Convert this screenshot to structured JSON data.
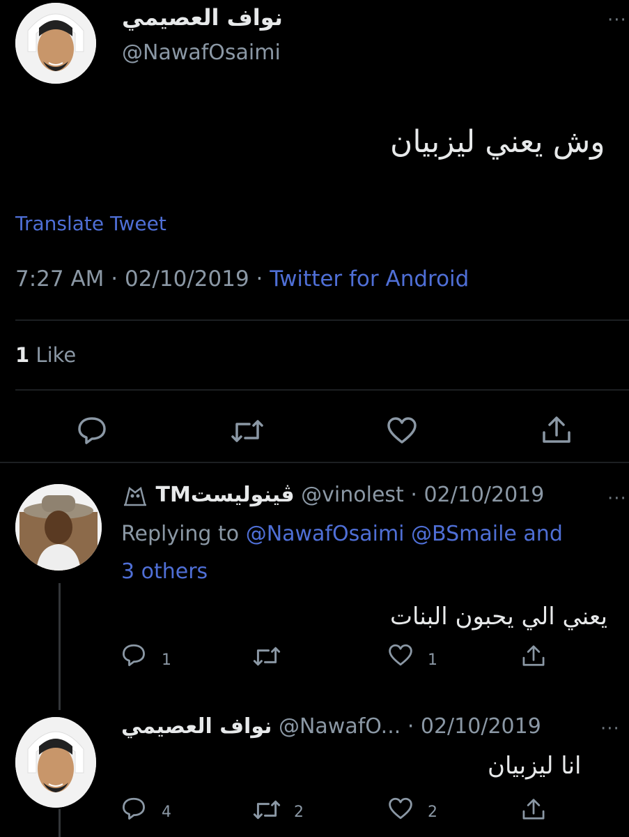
{
  "main_tweet": {
    "display_name": "نواف العصيمي",
    "handle": "@NawafOsaimi",
    "text": "وش يعني ليزبيان",
    "translate_label": "Translate Tweet",
    "time": "7:27 AM",
    "date": "02/10/2019",
    "sep": "·",
    "source": "Twitter for Android",
    "likes_count": "1",
    "likes_label": "Like",
    "more": "···"
  },
  "reply1": {
    "display_name": "ڤينوليستTM",
    "handle": "@vinolest",
    "date": "· 02/10/2019",
    "replying_prefix": "Replying to",
    "replying_line1": "@NawafOsaimi @BSmaile and",
    "replying_line2": "3 others",
    "text": "يعني الي يحبون البنات",
    "reply_count": "1",
    "retweet_count": "",
    "like_count": "1",
    "more": "···"
  },
  "reply2": {
    "display_name": "نواف العصيمي",
    "handle": "@NawafO...",
    "date": "· 02/10/2019",
    "text": "انا ليزبيان",
    "reply_count": "4",
    "retweet_count": "2",
    "like_count": "2",
    "more": "···"
  },
  "colors": {
    "background": "#000000",
    "link_blue": "#4f6fd6",
    "muted": "#8b98a5"
  },
  "icons": [
    "reply-icon",
    "retweet-icon",
    "like-icon",
    "share-icon",
    "owl-emoji-icon"
  ]
}
